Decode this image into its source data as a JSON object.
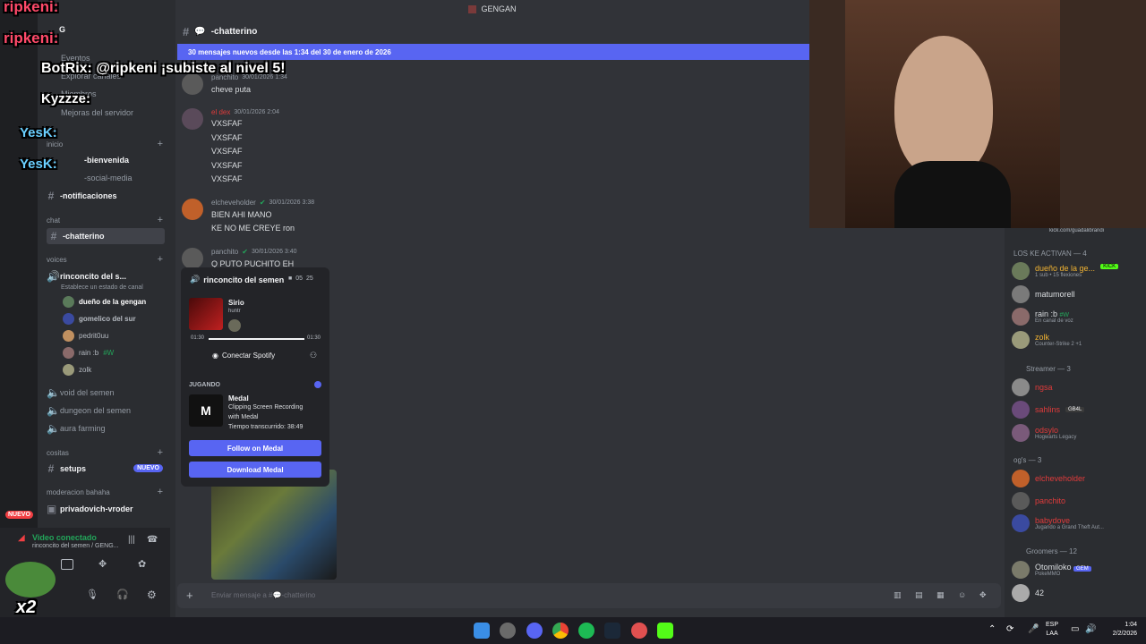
{
  "window_title": "GENGAN",
  "sidebar": {
    "server_initial": "G",
    "top_items": [
      "Eventos",
      "Explorar canales",
      "Miembros",
      "Mejoras del servidor"
    ],
    "cat_inicio": "inicio",
    "inicio_channels": [
      "-bienvenida",
      "-social-media",
      "-notificaciones"
    ],
    "cat_chat": "chat",
    "chatterino": "-chatterino",
    "cat_voices": "voices",
    "voice_channel": "rinconcito del s...",
    "voice_status": "Establece un estado de canal",
    "voice_users": [
      "dueño de la gengan",
      "gomelico del sur",
      "pedrit0uu",
      "rain :b",
      "zolk"
    ],
    "rain_tag": "#W",
    "other_voice": [
      "void del semen",
      "dungeon del semen",
      "aura farming"
    ],
    "cat_cositas": "cositas",
    "setups": "setups",
    "new_badge": "NUEVO",
    "cat_mod": "moderacion bahaha",
    "privado": "privadovich-vroder",
    "nuevo_rail": "NUEVO"
  },
  "voice_panel": {
    "status": "Video conectado",
    "location": "rinconcito del semen / GENG..."
  },
  "header": {
    "channel": "-chatterino"
  },
  "new_messages_bar": "30 mensajes nuevos desde las 1:34 del 30 de enero de 2026",
  "messages": [
    {
      "author": "panchito",
      "time": "30/01/2026 1:34",
      "lines": [
        "cheve puta"
      ],
      "color": "#949ba4"
    },
    {
      "author": "el dex",
      "time": "30/01/2026 2:04",
      "lines": [
        "VXSFAF",
        "VXSFAF",
        "VXSFAF",
        "VXSFAF",
        "VXSFAF"
      ],
      "color": "#e03b3b"
    },
    {
      "author": "elcheveholder",
      "time": "30/01/2026 3:38",
      "lines": [
        "BIEN AHI MANO",
        "KE NO ME CREYE ron"
      ],
      "color": "#949ba4"
    },
    {
      "author": "panchito",
      "time": "30/01/2026 3:40",
      "lines": [
        "Q PUTO PUCHITO EH"
      ],
      "color": "#949ba4"
    }
  ],
  "popout": {
    "channel": "rinconcito del semen",
    "count_a": "05",
    "count_b": "25",
    "track": "Sirio",
    "artist": "huntr",
    "time_start": "01:30",
    "time_end": "01:30",
    "progress": 1.0,
    "spotify": "Conectar Spotify",
    "playing_label": "JUGANDO",
    "app": "Medal",
    "app_desc1": "Clipping Screen Recording",
    "app_desc2": "with Medal",
    "elapsed": "Tiempo transcurrido: 38:49",
    "follow": "Follow on Medal",
    "download": "Download Medal"
  },
  "composer": {
    "placeholder": "Enviar mensaje a #💬-chatterino"
  },
  "members": {
    "kick_link": "kick.com/guadalibrandi",
    "group1": "LOS KE ACTIVAN — 4",
    "group2": "Streamer — 3",
    "group3": "og's — 3",
    "group4": "Groomers — 12",
    "list": [
      {
        "name": "dueño de la ge...",
        "sub": "1 sub • 15 flexiones",
        "tag": "KICK",
        "color": "#f0b232"
      },
      {
        "name": "matumorell",
        "sub": "",
        "tag": "",
        "color": "#dbdee1"
      },
      {
        "name": "rain :b",
        "sub": "En canal de voz",
        "tag": "#W",
        "color": "#dbdee1"
      },
      {
        "name": "zolk",
        "sub": "Counter-Strike 2 +1",
        "tag": "",
        "color": "#f0b232"
      },
      {
        "name": "ngsa",
        "sub": "",
        "tag": "",
        "color": "#e03b3b"
      },
      {
        "name": "sahlins",
        "sub": "",
        "tag": "GB4L",
        "color": "#e03b3b"
      },
      {
        "name": "odsylo",
        "sub": "Hogwarts Legacy",
        "tag": "",
        "color": "#e03b3b"
      },
      {
        "name": "elcheveholder",
        "sub": "",
        "tag": "",
        "color": "#e03b3b"
      },
      {
        "name": "panchito",
        "sub": "",
        "tag": "",
        "color": "#e03b3b"
      },
      {
        "name": "babydove",
        "sub": "Jugando a Grand Theft Aut...",
        "tag": "",
        "color": "#e03b3b"
      },
      {
        "name": "Otomiloko",
        "sub": "PokeMMO",
        "tag": "GEM",
        "color": "#dbdee1"
      },
      {
        "name": "42",
        "sub": "",
        "tag": "",
        "color": "#dbdee1"
      }
    ]
  },
  "overlay": {
    "chat1": "ripkeni:",
    "chat2": "ripkeni:",
    "chat3": "BotRix: @ripkeni ¡subiste al nivel 5!",
    "chat4": "Kyzzze:",
    "chat5": "YesK:",
    "chat6": "YesK:",
    "x2": "x2"
  },
  "taskbar": {
    "lang1": "ESP",
    "lang2": "LAA",
    "time": "1:04",
    "date": "2/2/2026"
  }
}
